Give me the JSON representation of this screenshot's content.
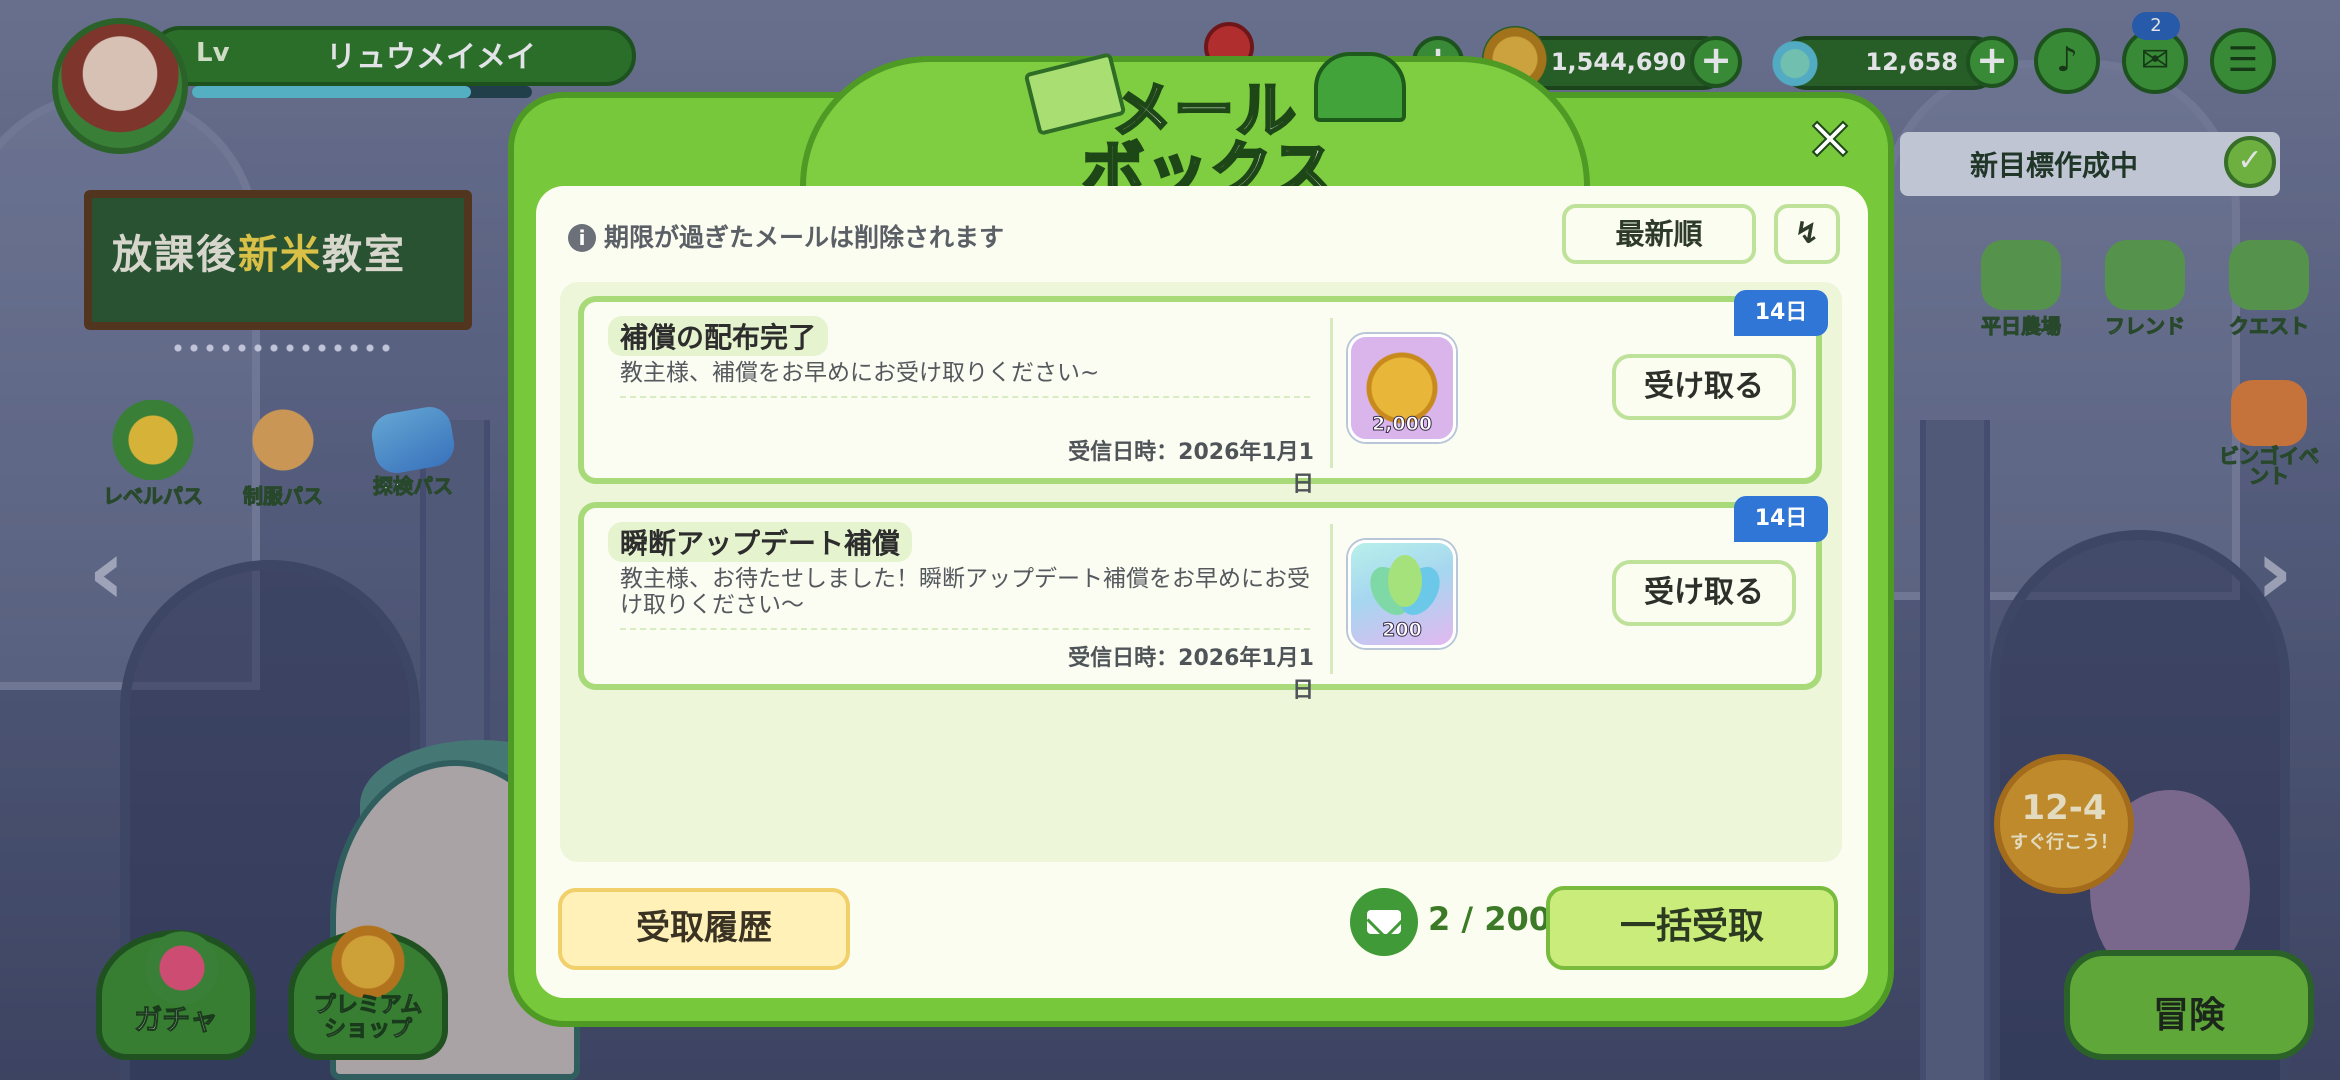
{
  "player": {
    "level_label": "Lv",
    "name": "リュウメイメイ"
  },
  "currencies": [
    {
      "name": "coin",
      "value": "1,544,690",
      "icon": "gold-coin-icon"
    },
    {
      "name": "leaf-gem",
      "value": "12,658",
      "icon": "leaf-gem-icon"
    }
  ],
  "hud": {
    "notification_count": "2",
    "icons": [
      "bell-icon",
      "mailbox-icon",
      "menu-icon"
    ]
  },
  "banner": {
    "title_a": "放課後",
    "title_highlight": "新米",
    "title_b": "教室"
  },
  "side_menu": [
    "レベルパス",
    "制服パス",
    "探検パス"
  ],
  "right_menu": [
    "平日農場",
    "フレンド",
    "クエスト"
  ],
  "goal": {
    "text": "新目標作成中"
  },
  "event": {
    "label_1": "ビンゴイベ",
    "label_2": "ント"
  },
  "stage": {
    "number": "12-4",
    "go": "すぐ行こう！"
  },
  "bottom_menu": {
    "gacha": "ガチャ",
    "premium_1": "プレミアム",
    "premium_2": "ショップ",
    "adventure": "冒険"
  },
  "mailbox": {
    "title_line1": "メール",
    "title_line2": "ボックス",
    "notice": "期限が過ぎたメールは削除されます",
    "sort_label": "最新順",
    "mails": [
      {
        "title": "補償の配布完了",
        "body": "教主様、補償をお早めにお受け取りください~",
        "date": "受信日時：2026年1月1日",
        "reward_qty": "2,000",
        "reward_icon": "gold-coin-icon",
        "days_left": "14日",
        "button": "受け取る"
      },
      {
        "title": "瞬断アップデート補償",
        "body": "教主様、お待たせしました！瞬断アップデート補償をお早めにお受け取りください～",
        "date": "受信日時：2026年1月1日",
        "reward_qty": "200",
        "reward_icon": "leaf-gem-icon",
        "days_left": "14日",
        "button": "受け取る"
      }
    ],
    "history_button": "受取履歴",
    "mail_count": "2 / 200",
    "claim_all_button": "一括受取"
  },
  "colors": {
    "modal_green": "#78c83c",
    "panel_bg": "#fbfdf0",
    "days_tag_blue": "#2f76d6",
    "history_yellow": "#fff1b8",
    "claim_all_green": "#c9ec7a"
  }
}
